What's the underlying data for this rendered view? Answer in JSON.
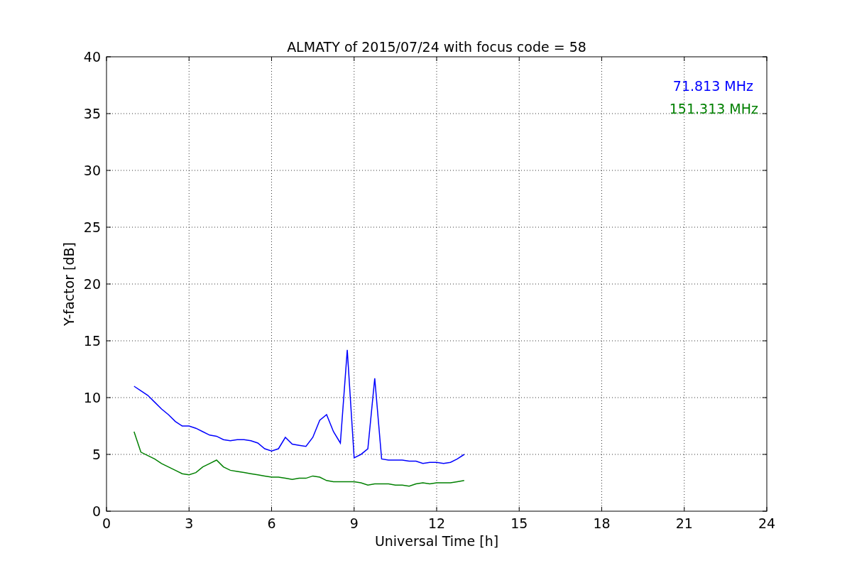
{
  "figure": {
    "chart_data": {
      "type": "line",
      "title": "ALMATY of 2015/07/24 with focus code = 58",
      "xlabel": "Universal Time [h]",
      "ylabel": "Y-factor [dB]",
      "x": [
        1,
        1.25,
        1.5,
        1.75,
        2,
        2.25,
        2.5,
        2.75,
        3,
        3.25,
        3.5,
        3.75,
        4,
        4.25,
        4.5,
        4.75,
        5,
        5.25,
        5.5,
        5.75,
        6,
        6.25,
        6.5,
        6.75,
        7,
        7.25,
        7.5,
        7.75,
        8,
        8.25,
        8.5,
        8.75,
        9,
        9.25,
        9.5,
        9.75,
        10,
        10.25,
        10.5,
        10.75,
        11,
        11.25,
        11.5,
        11.75,
        12,
        12.25,
        12.5,
        12.75,
        13
      ],
      "series": [
        {
          "name": "71.813 MHz",
          "color": "#0000ff",
          "values": [
            11,
            10.6,
            10.2,
            9.6,
            9,
            8.5,
            7.9,
            7.5,
            7.5,
            7.3,
            7,
            6.7,
            6.6,
            6.3,
            6.2,
            6.3,
            6.3,
            6.2,
            6,
            5.5,
            5.3,
            5.5,
            6.5,
            5.9,
            5.8,
            5.7,
            6.5,
            8,
            8.5,
            7,
            6,
            14.2,
            4.7,
            5,
            5.5,
            11.7,
            4.6,
            4.5,
            4.5,
            4.5,
            4.4,
            4.4,
            4.2,
            4.3,
            4.3,
            4.2,
            4.3,
            4.6,
            5
          ]
        },
        {
          "name": "151.313 MHz",
          "color": "#008000",
          "values": [
            7,
            5.2,
            4.9,
            4.6,
            4.2,
            3.9,
            3.6,
            3.3,
            3.2,
            3.4,
            3.9,
            4.2,
            4.5,
            3.9,
            3.6,
            3.5,
            3.4,
            3.3,
            3.2,
            3.1,
            3,
            3,
            2.9,
            2.8,
            2.9,
            2.9,
            3.1,
            3,
            2.7,
            2.6,
            2.6,
            2.6,
            2.6,
            2.5,
            2.3,
            2.4,
            2.4,
            2.4,
            2.3,
            2.3,
            2.2,
            2.4,
            2.5,
            2.4,
            2.5,
            2.5,
            2.5,
            2.6,
            2.7
          ]
        }
      ],
      "grid": true,
      "xlim": [
        0,
        24
      ],
      "ylim": [
        0,
        40
      ],
      "xticks": [
        0,
        3,
        6,
        9,
        12,
        15,
        18,
        21,
        24
      ],
      "yticks": [
        0,
        5,
        10,
        15,
        20,
        25,
        30,
        35,
        40
      ]
    }
  }
}
